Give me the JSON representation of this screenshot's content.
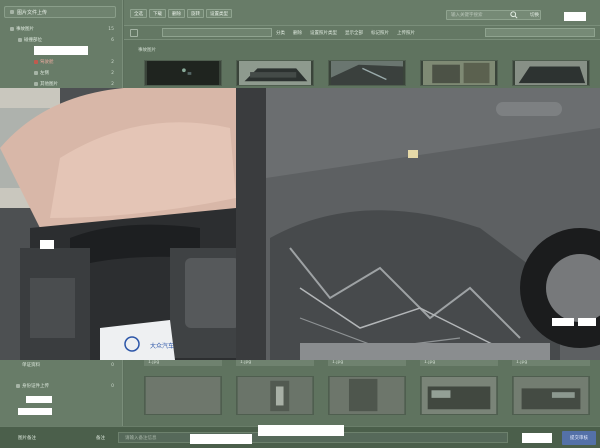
{
  "sidebar": {
    "root_label": "图片文件上传",
    "tree": [
      {
        "label": "事故图片",
        "count": "15"
      },
      {
        "label": "碰撞部位",
        "count": "6"
      },
      {
        "label": "驾驶舱",
        "count": "2"
      },
      {
        "label": "左侧",
        "count": "2"
      },
      {
        "label": "其他图片",
        "count": "2"
      }
    ],
    "bottom_items": [
      {
        "label": "单证资料",
        "count": "0"
      },
      {
        "label": "身份证件上传",
        "count": "0"
      }
    ]
  },
  "header": {
    "toolbar": [
      "全选",
      "下载",
      "删除",
      "旋转",
      "设置类型"
    ],
    "search_placeholder": "输入关键字搜索",
    "right_label": "切换"
  },
  "filterbar": {
    "items": [
      "分类",
      "删除",
      "设置照片类型",
      "显示全部",
      "标记照片",
      "上传照片"
    ]
  },
  "gallery": {
    "section_label": "事故图片",
    "top_captions": [
      "",
      "",
      "",
      "",
      ""
    ],
    "mid_captions": [
      "1.jpg",
      "1.jpg",
      "1.jpg",
      "1.jpg",
      "1.jpg"
    ]
  },
  "bottombar": {
    "label_left": "图片备注",
    "label_mid": "备注",
    "input_placeholder": "请输入备注信息",
    "submit": "提交审核"
  },
  "preview": {
    "bag_text": "大众汽车"
  },
  "colors": {
    "accent": "#5471a8",
    "panel": "#687c68",
    "overlay": "#5c6f5c"
  }
}
